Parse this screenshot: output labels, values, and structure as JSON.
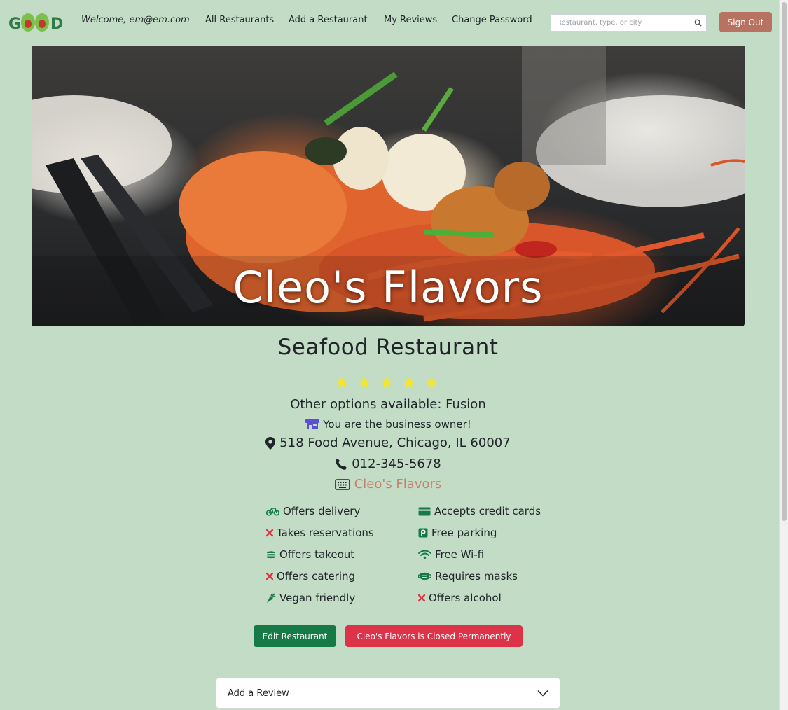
{
  "navbar": {
    "logo_text": "GOOD",
    "welcome": "Welcome, em@em.com",
    "links": [
      "All Restaurants",
      "Add a Restaurant",
      "My Reviews",
      "Change Password"
    ],
    "search_placeholder": "Restaurant, type, or city",
    "signout_label": "Sign Out"
  },
  "hero": {
    "restaurant_name": "Cleo's Flavors"
  },
  "details": {
    "category": "Seafood Restaurant",
    "rating_stars": 5,
    "other_options": "Other options available: Fusion",
    "owner_note": "You are the business owner!",
    "address": "518 Food Avenue, Chicago, IL 60007",
    "phone": "012-345-5678",
    "website": "Cleo's Flavors"
  },
  "amenities": {
    "left": [
      {
        "label": "Offers delivery",
        "available": true,
        "icon": "bicycle-icon"
      },
      {
        "label": "Takes reservations",
        "available": false,
        "icon": "x-icon"
      },
      {
        "label": "Offers takeout",
        "available": true,
        "icon": "burger-icon"
      },
      {
        "label": "Offers catering",
        "available": false,
        "icon": "x-icon"
      },
      {
        "label": "Vegan friendly",
        "available": true,
        "icon": "carrot-icon"
      }
    ],
    "right": [
      {
        "label": "Accepts credit cards",
        "available": true,
        "icon": "credit-card-icon"
      },
      {
        "label": "Free parking",
        "available": true,
        "icon": "parking-icon"
      },
      {
        "label": "Free Wi-fi",
        "available": true,
        "icon": "wifi-icon"
      },
      {
        "label": "Requires masks",
        "available": true,
        "icon": "mask-icon"
      },
      {
        "label": "Offers alcohol",
        "available": false,
        "icon": "x-icon"
      }
    ]
  },
  "actions": {
    "edit_label": "Edit Restaurant",
    "closed_label": "Cleo's Flavors is Closed Permanently"
  },
  "review": {
    "accordion_label": "Add a Review"
  },
  "colors": {
    "background": "#c2dcc6",
    "brand_green": "#157a45",
    "danger": "#dc3348",
    "signout": "#b87262",
    "link": "#c4806f",
    "star": "#f5e52c",
    "x_red": "#dc3545",
    "owner_icon": "#5b4fd6"
  }
}
